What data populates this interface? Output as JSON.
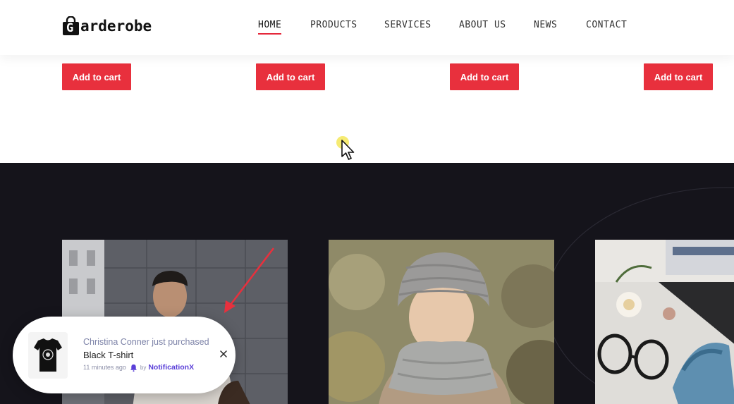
{
  "header": {
    "logo_text": "arderobe",
    "logo_letter": "G",
    "nav": [
      {
        "label": "HOME",
        "active": true
      },
      {
        "label": "PRODUCTS",
        "active": false
      },
      {
        "label": "SERVICES",
        "active": false
      },
      {
        "label": "ABOUT US",
        "active": false
      },
      {
        "label": "NEWS",
        "active": false
      },
      {
        "label": "CONTACT",
        "active": false
      }
    ]
  },
  "products": {
    "add_to_cart_buttons": [
      "Add to cart",
      "Add to cart",
      "Add to cart",
      "Add to cart"
    ]
  },
  "gallery": {
    "photos": [
      "man-in-hoodie-photo",
      "woman-in-knit-hat-photo",
      "flatlay-accessories-photo"
    ]
  },
  "notification": {
    "title": "Christina Conner just purchased",
    "product": "Black T-shirt",
    "time": "11 minutes ago",
    "by": "by",
    "brand": "NotificationX",
    "thumb_icon": "black-tshirt-icon",
    "close_icon": "close-icon"
  },
  "colors": {
    "accent": "#e8303d",
    "dark_section": "#15141b",
    "notification_brand": "#5a3fd8"
  }
}
